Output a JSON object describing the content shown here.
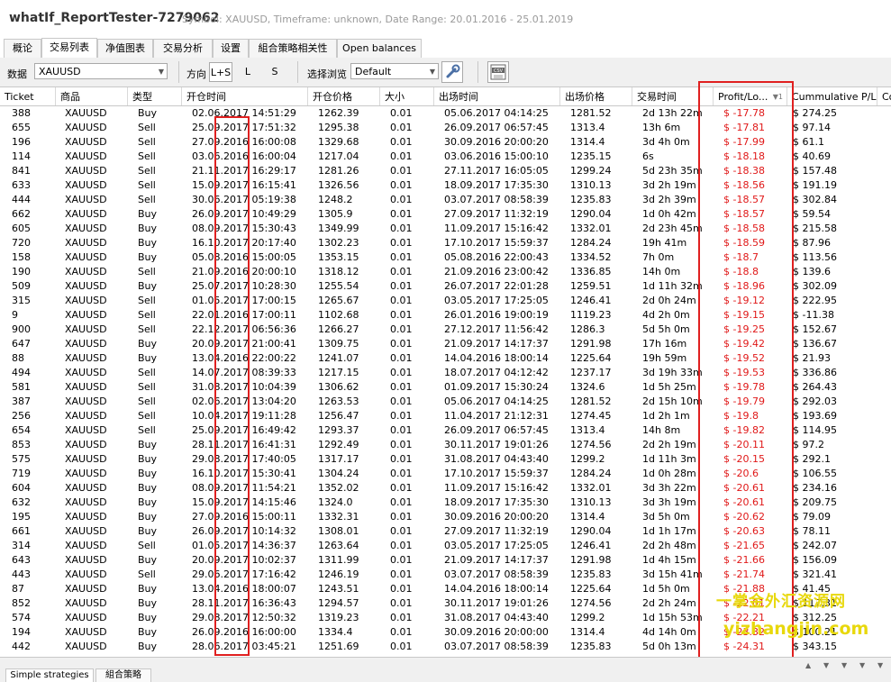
{
  "window": {
    "title": "whatIf_ReportTester-7279062",
    "subtitle": "Symbol: XAUUSD, Timeframe: unknown, Date Range: 20.01.2016 - 25.01.2019"
  },
  "tabs": [
    "概论",
    "交易列表",
    "净值图表",
    "交易分析",
    "设置",
    "組合策略相关性",
    "Open balances"
  ],
  "active_tab": "交易列表",
  "toolbar": {
    "data_label": "数据",
    "data_value": "XAUUSD",
    "direction_label": "方向",
    "dir_options": [
      "L+S",
      "L",
      "S"
    ],
    "view_label": "选择浏览",
    "view_value": "Default",
    "csv_label": "CSV"
  },
  "columns": [
    "Ticket",
    "商品",
    "类型",
    "开仓时间",
    "开仓价格",
    "大小",
    "出场时间",
    "出场价格",
    "交易时间",
    "Profit/Lo...",
    "Cummulative P/L",
    "Co"
  ],
  "sort_indicator": "1",
  "rows": [
    [
      "388",
      "XAUUSD",
      "Buy",
      "02.06.2017 14:51:29",
      "1262.39",
      "0.01",
      "05.06.2017 04:14:25",
      "1281.52",
      "2d 13h 22m",
      "$ -17.78",
      "$ 274.25"
    ],
    [
      "655",
      "XAUUSD",
      "Sell",
      "25.09.2017 17:51:32",
      "1295.38",
      "0.01",
      "26.09.2017 06:57:45",
      "1313.4",
      "13h 6m",
      "$ -17.81",
      "$ 97.14"
    ],
    [
      "196",
      "XAUUSD",
      "Sell",
      "27.09.2016 16:00:08",
      "1329.68",
      "0.01",
      "30.09.2016 20:00:20",
      "1314.4",
      "3d 4h 0m",
      "$ -17.99",
      "$ 61.1"
    ],
    [
      "114",
      "XAUUSD",
      "Sell",
      "03.06.2016 16:00:04",
      "1217.04",
      "0.01",
      "03.06.2016 15:00:10",
      "1235.15",
      "6s",
      "$ -18.18",
      "$ 40.69"
    ],
    [
      "841",
      "XAUUSD",
      "Sell",
      "21.11.2017 16:29:17",
      "1281.26",
      "0.01",
      "27.11.2017 16:05:05",
      "1299.24",
      "5d 23h 35m",
      "$ -18.38",
      "$ 157.48"
    ],
    [
      "633",
      "XAUUSD",
      "Sell",
      "15.09.2017 16:15:41",
      "1326.56",
      "0.01",
      "18.09.2017 17:35:30",
      "1310.13",
      "3d 2h 19m",
      "$ -18.56",
      "$ 191.19"
    ],
    [
      "444",
      "XAUUSD",
      "Sell",
      "30.06.2017 05:19:38",
      "1248.2",
      "0.01",
      "03.07.2017 08:58:39",
      "1235.83",
      "3d 2h 39m",
      "$ -18.57",
      "$ 302.84"
    ],
    [
      "662",
      "XAUUSD",
      "Buy",
      "26.09.2017 10:49:29",
      "1305.9",
      "0.01",
      "27.09.2017 11:32:19",
      "1290.04",
      "1d 0h 42m",
      "$ -18.57",
      "$ 59.54"
    ],
    [
      "605",
      "XAUUSD",
      "Buy",
      "08.09.2017 15:30:43",
      "1349.99",
      "0.01",
      "11.09.2017 15:16:42",
      "1332.01",
      "2d 23h 45m",
      "$ -18.58",
      "$ 215.58"
    ],
    [
      "720",
      "XAUUSD",
      "Buy",
      "16.10.2017 20:17:40",
      "1302.23",
      "0.01",
      "17.10.2017 15:59:37",
      "1284.24",
      "19h 41m",
      "$ -18.59",
      "$ 87.96"
    ],
    [
      "158",
      "XAUUSD",
      "Buy",
      "05.08.2016 15:00:05",
      "1353.15",
      "0.01",
      "05.08.2016 22:00:43",
      "1334.52",
      "7h 0m",
      "$ -18.7",
      "$ 113.56"
    ],
    [
      "190",
      "XAUUSD",
      "Sell",
      "21.09.2016 20:00:10",
      "1318.12",
      "0.01",
      "21.09.2016 23:00:42",
      "1336.85",
      "14h 0m",
      "$ -18.8",
      "$ 139.6"
    ],
    [
      "509",
      "XAUUSD",
      "Buy",
      "25.07.2017 10:28:30",
      "1255.54",
      "0.01",
      "26.07.2017 22:01:28",
      "1259.51",
      "1d 11h 32m",
      "$ -18.96",
      "$ 302.09"
    ],
    [
      "315",
      "XAUUSD",
      "Sell",
      "01.05.2017 17:00:15",
      "1265.67",
      "0.01",
      "03.05.2017 17:25:05",
      "1246.41",
      "2d 0h 24m",
      "$ -19.12",
      "$ 222.95"
    ],
    [
      "9",
      "XAUUSD",
      "Sell",
      "22.01.2016 17:00:11",
      "1102.68",
      "0.01",
      "26.01.2016 19:00:19",
      "1119.23",
      "4d 2h 0m",
      "$ -19.15",
      "$ -11.38"
    ],
    [
      "900",
      "XAUUSD",
      "Sell",
      "22.12.2017 06:56:36",
      "1266.27",
      "0.01",
      "27.12.2017 11:56:42",
      "1286.3",
      "5d 5h 0m",
      "$ -19.25",
      "$ 152.67"
    ],
    [
      "647",
      "XAUUSD",
      "Buy",
      "20.09.2017 21:00:41",
      "1309.75",
      "0.01",
      "21.09.2017 14:17:37",
      "1291.98",
      "17h 16m",
      "$ -19.42",
      "$ 136.67"
    ],
    [
      "88",
      "XAUUSD",
      "Buy",
      "13.04.2016 22:00:22",
      "1241.07",
      "0.01",
      "14.04.2016 18:00:14",
      "1225.64",
      "19h 59m",
      "$ -19.52",
      "$ 21.93"
    ],
    [
      "494",
      "XAUUSD",
      "Sell",
      "14.07.2017 08:39:33",
      "1217.15",
      "0.01",
      "18.07.2017 04:12:42",
      "1237.17",
      "3d 19h 33m",
      "$ -19.53",
      "$ 336.86"
    ],
    [
      "581",
      "XAUUSD",
      "Sell",
      "31.08.2017 10:04:39",
      "1306.62",
      "0.01",
      "01.09.2017 15:30:24",
      "1324.6",
      "1d 5h 25m",
      "$ -19.78",
      "$ 264.43"
    ],
    [
      "387",
      "XAUUSD",
      "Sell",
      "02.06.2017 13:04:20",
      "1263.53",
      "0.01",
      "05.06.2017 04:14:25",
      "1281.52",
      "2d 15h 10m",
      "$ -19.79",
      "$ 292.03"
    ],
    [
      "256",
      "XAUUSD",
      "Sell",
      "10.04.2017 19:11:28",
      "1256.47",
      "0.01",
      "11.04.2017 21:12:31",
      "1274.45",
      "1d 2h 1m",
      "$ -19.8",
      "$ 193.69"
    ],
    [
      "654",
      "XAUUSD",
      "Sell",
      "25.09.2017 16:49:42",
      "1293.37",
      "0.01",
      "26.09.2017 06:57:45",
      "1313.4",
      "14h 8m",
      "$ -19.82",
      "$ 114.95"
    ],
    [
      "853",
      "XAUUSD",
      "Buy",
      "28.11.2017 16:41:31",
      "1292.49",
      "0.01",
      "30.11.2017 19:01:26",
      "1274.56",
      "2d 2h 19m",
      "$ -20.11",
      "$ 97.2"
    ],
    [
      "575",
      "XAUUSD",
      "Buy",
      "29.08.2017 17:40:05",
      "1317.17",
      "0.01",
      "31.08.2017 04:43:40",
      "1299.2",
      "1d 11h 3m",
      "$ -20.15",
      "$ 292.1"
    ],
    [
      "719",
      "XAUUSD",
      "Buy",
      "16.10.2017 15:30:41",
      "1304.24",
      "0.01",
      "17.10.2017 15:59:37",
      "1284.24",
      "1d 0h 28m",
      "$ -20.6",
      "$ 106.55"
    ],
    [
      "604",
      "XAUUSD",
      "Buy",
      "08.09.2017 11:54:21",
      "1352.02",
      "0.01",
      "11.09.2017 15:16:42",
      "1332.01",
      "3d 3h 22m",
      "$ -20.61",
      "$ 234.16"
    ],
    [
      "632",
      "XAUUSD",
      "Buy",
      "15.09.2017 14:15:46",
      "1324.0",
      "0.01",
      "18.09.2017 17:35:30",
      "1310.13",
      "3d 3h 19m",
      "$ -20.61",
      "$ 209.75"
    ],
    [
      "195",
      "XAUUSD",
      "Buy",
      "27.09.2016 15:00:11",
      "1332.31",
      "0.01",
      "30.09.2016 20:00:20",
      "1314.4",
      "3d 5h 0m",
      "$ -20.62",
      "$ 79.09"
    ],
    [
      "661",
      "XAUUSD",
      "Buy",
      "26.09.2017 10:14:32",
      "1308.01",
      "0.01",
      "27.09.2017 11:32:19",
      "1290.04",
      "1d 1h 17m",
      "$ -20.63",
      "$ 78.11"
    ],
    [
      "314",
      "XAUUSD",
      "Sell",
      "01.05.2017 14:36:37",
      "1263.64",
      "0.01",
      "03.05.2017 17:25:05",
      "1246.41",
      "2d 2h 48m",
      "$ -21.65",
      "$ 242.07"
    ],
    [
      "643",
      "XAUUSD",
      "Buy",
      "20.09.2017 10:02:37",
      "1311.99",
      "0.01",
      "21.09.2017 14:17:37",
      "1291.98",
      "1d 4h 15m",
      "$ -21.66",
      "$ 156.09"
    ],
    [
      "443",
      "XAUUSD",
      "Sell",
      "29.06.2017 17:16:42",
      "1246.19",
      "0.01",
      "03.07.2017 08:58:39",
      "1235.83",
      "3d 15h 41m",
      "$ -21.74",
      "$ 321.41"
    ],
    [
      "87",
      "XAUUSD",
      "Buy",
      "13.04.2016 18:00:07",
      "1243.51",
      "0.01",
      "14.04.2016 18:00:14",
      "1225.64",
      "1d 5h 0m",
      "$ -21.88",
      "$ 41.45"
    ],
    [
      "852",
      "XAUUSD",
      "Buy",
      "28.11.2017 16:36:43",
      "1294.57",
      "0.01",
      "30.11.2017 19:01:26",
      "1274.56",
      "2d 2h 24m",
      "$ -22.01",
      "$ 117.31"
    ],
    [
      "574",
      "XAUUSD",
      "Buy",
      "29.08.2017 12:50:32",
      "1319.23",
      "0.01",
      "31.08.2017 04:43:40",
      "1299.2",
      "1d 15h 53m",
      "$ -22.21",
      "$ 312.25"
    ],
    [
      "194",
      "XAUUSD",
      "Buy",
      "26.09.2016 16:00:00",
      "1334.4",
      "0.01",
      "30.09.2016 20:00:00",
      "1314.4",
      "4d 14h 0m",
      "$ -23.32",
      "$ 100.21"
    ],
    [
      "442",
      "XAUUSD",
      "Buy",
      "28.06.2017 03:45:21",
      "1251.69",
      "0.01",
      "03.07.2017 08:58:39",
      "1235.83",
      "5d 0h 13m",
      "$ -24.31",
      "$ 343.15"
    ]
  ],
  "bottom_tabs": [
    "Simple strategies",
    "組合策略"
  ],
  "watermark": {
    "line1": "一掌金外汇资源网",
    "line2": "yizhangjin.com"
  },
  "colors": {
    "negative": "#e01818",
    "highlight": "#e02020",
    "watermark": "#e8d80c"
  }
}
